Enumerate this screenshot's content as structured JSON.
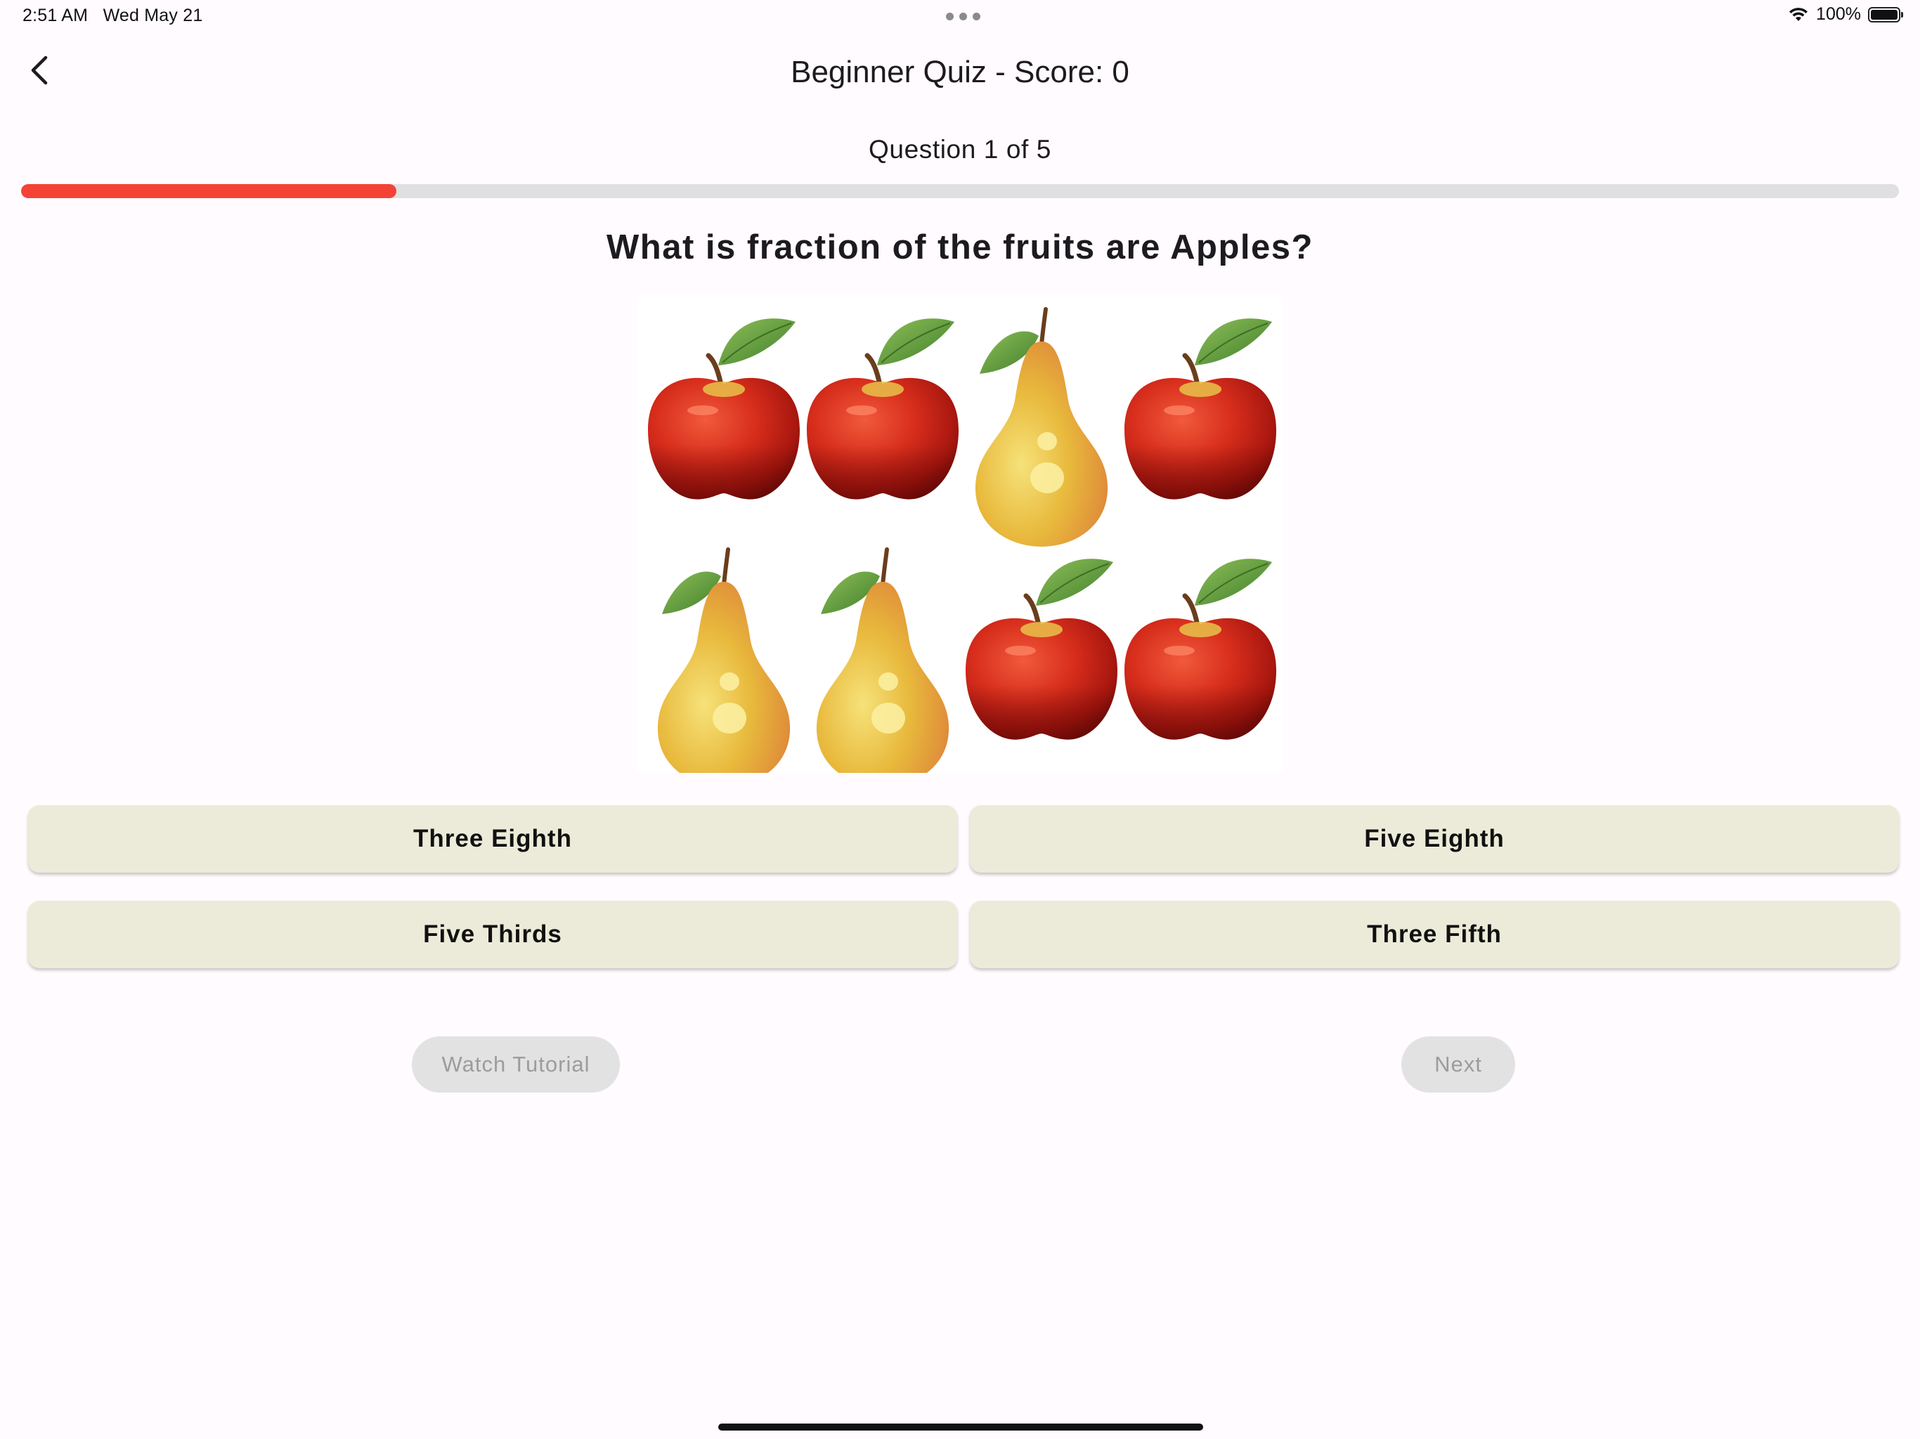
{
  "status_bar": {
    "time": "2:51 AM",
    "date": "Wed May 21",
    "battery_percent": "100%",
    "icons": [
      "multitask-dots-icon",
      "wifi-icon",
      "battery-icon"
    ]
  },
  "app_bar": {
    "back_icon": "chevron-left-icon",
    "title": "Beginner Quiz - Score: 0"
  },
  "quiz": {
    "counter": "Question 1 of 5",
    "progress_fraction": 0.2,
    "progress_color": "#f44336",
    "question": "What is fraction of the fruits are Apples?",
    "image": {
      "fruits": [
        "apple",
        "apple",
        "pear",
        "apple",
        "pear",
        "pear",
        "apple",
        "apple"
      ]
    },
    "answers": [
      {
        "label": "Three Eighth"
      },
      {
        "label": "Five Eighth"
      },
      {
        "label": "Five Thirds"
      },
      {
        "label": "Three Fifth"
      }
    ]
  },
  "actions": {
    "watch_tutorial": "Watch Tutorial",
    "next": "Next"
  }
}
